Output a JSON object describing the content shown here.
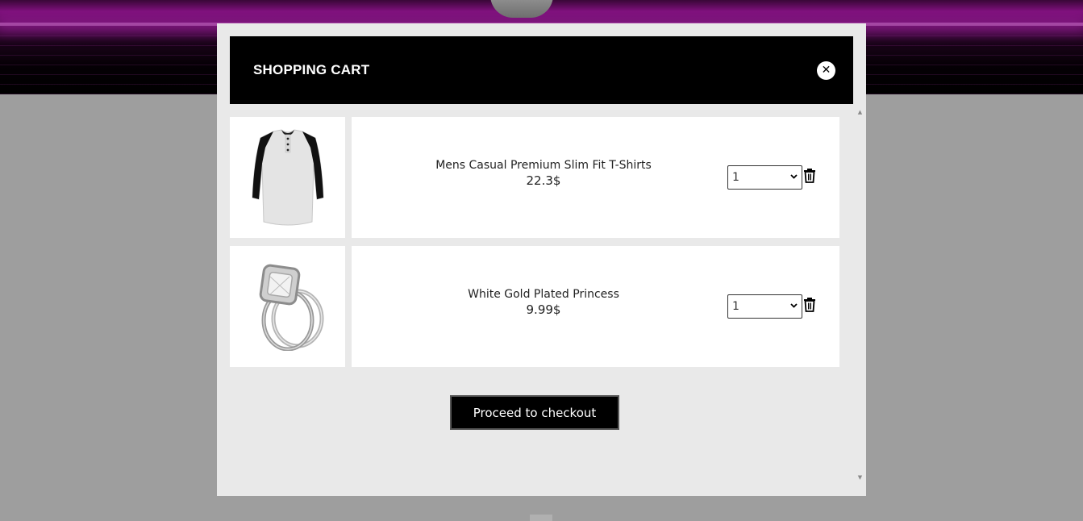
{
  "modal": {
    "title": "SHOPPING CART",
    "close_icon": "close-icon",
    "close_glyph": "✕"
  },
  "cart": {
    "items": [
      {
        "name": "Mens Casual Premium Slim Fit T-Shirts",
        "price": "22.3$",
        "quantity": "1",
        "image_icon": "tshirt-image",
        "delete_icon": "trash-icon"
      },
      {
        "name": "White Gold Plated Princess",
        "price": "9.99$",
        "quantity": "1",
        "image_icon": "ring-image",
        "delete_icon": "trash-icon"
      }
    ],
    "checkout_label": "Proceed to checkout"
  },
  "colors": {
    "header_bg": "#000000",
    "modal_bg": "#e9e9e9",
    "card_bg": "#ffffff",
    "overlay": "#9e9e9e",
    "hero_accent": "#7a0f78"
  }
}
